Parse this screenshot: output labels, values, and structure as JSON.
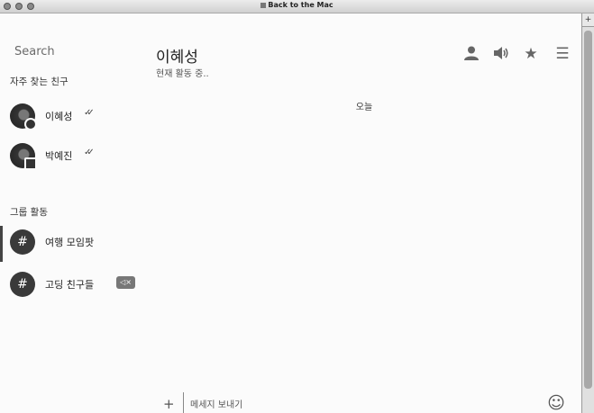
{
  "window": {
    "title": "Back to the Mac"
  },
  "sidebar": {
    "search_label": "Search",
    "favorites_title": "자주 찾는 친구",
    "favorites": [
      {
        "name": "이혜성",
        "status": "✓✓"
      },
      {
        "name": "박예진",
        "status": "✓✓"
      }
    ],
    "groups_title": "그룹 활동",
    "groups": [
      {
        "name": "여행 모임팟",
        "icon": "#"
      },
      {
        "name": "고딩 친구들",
        "icon": "#",
        "badge": "◁×"
      }
    ]
  },
  "chat": {
    "title": "이혜성",
    "status": "현재 활동 중..",
    "date_divider": "오늘",
    "compose_placeholder": "메세지 보내기"
  },
  "icons": {
    "profile": "person-icon",
    "sound": "speaker-icon",
    "favorite": "star-icon",
    "menu": "hamburger-icon",
    "emoji": "smiley-icon"
  }
}
